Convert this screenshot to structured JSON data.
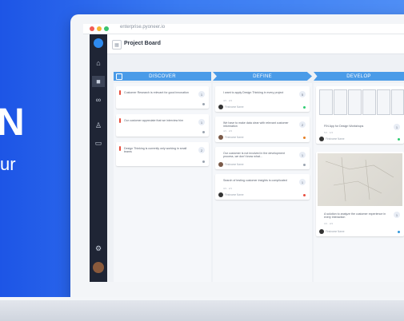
{
  "hero": {
    "letter": "N",
    "subtitle": "ur"
  },
  "browser": {
    "url": "enterprise.pyoneer.io",
    "dots": [
      "#f25c54",
      "#f7b731",
      "#3bc46d"
    ]
  },
  "header": {
    "title": "Project Board"
  },
  "phases": [
    "DISCOVER",
    "DEFINE",
    "DEVELOP"
  ],
  "discover": [
    {
      "text": "Customer Research is relevant for good innovation",
      "badge": "1",
      "mark": "#e74c3c"
    },
    {
      "text": "Our customer appreciate that we interview him",
      "badge": "1",
      "mark": "#e74c3c"
    },
    {
      "text": "Design Thinking is currently only working in small teams",
      "badge": "2",
      "mark": "#e74c3c"
    }
  ],
  "define": [
    {
      "text": "I want to apply Design Thinking in every project",
      "badge": "5",
      "meta": "4/1  ·  2/4",
      "owner": "Firstname Name",
      "dot": "#2ecc71"
    },
    {
      "text": "We have to make data clear with relevant customer information",
      "badge": "2",
      "meta": "4/1  ·  2/4",
      "owner": "Firstname Name",
      "dot": "#e67e22"
    },
    {
      "text": "Our customer is not involved in the development process, we don't know what...",
      "badge": "1",
      "owner": "Firstname Name",
      "dot": "#9aa3af"
    },
    {
      "text": "Search of testing customer insights is complicated",
      "badge": "1",
      "meta": "3/1  ·  2/1",
      "owner": "Firstname Name",
      "dot": "#e74c3c"
    }
  ],
  "develop": [
    {
      "text": "FIN App for Design Workshops",
      "badge": "1",
      "meta": "5/1  ·  1/4",
      "owner": "Firstname Name",
      "dot": "#2ecc71"
    },
    {
      "text": "A solution to analyze the customer experience in every interaction",
      "badge": "1",
      "meta": "3/1  ·  2/4",
      "owner": "Firstname Name",
      "dot": "#3498db"
    }
  ]
}
